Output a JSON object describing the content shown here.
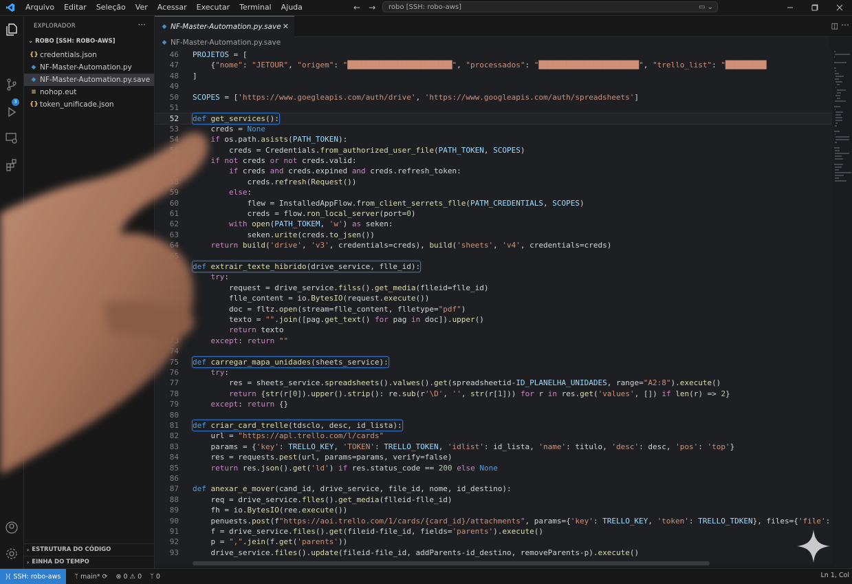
{
  "titlebar": {
    "menu": [
      "Arquivo",
      "Editar",
      "Seleção",
      "Ver",
      "Acessar",
      "Executar",
      "Terminal",
      "Ajuda"
    ],
    "search_text": "robo [SSH: robo-aws]",
    "nav_back": "←",
    "nav_forward": "→"
  },
  "sidebar": {
    "title": "EXPLORADOR",
    "more": "···",
    "root": "ROBO [SSH: ROBO-AWS]",
    "files": [
      {
        "name": "credentials.json",
        "icon": "{}"
      },
      {
        "name": "NF-Master-Automation.py",
        "icon": "py"
      },
      {
        "name": "NF-Master-Automation.py.save",
        "icon": "py"
      },
      {
        "name": "nohop.eut",
        "icon": "≡"
      },
      {
        "name": "token_unificade.json",
        "icon": "{}"
      }
    ],
    "sections": [
      "ESTRUTURA DO CÓDIGO",
      "EINHA DO TEMPO"
    ]
  },
  "editor": {
    "tab_label": "NF-Master-Automation.py.save",
    "breadcrumb": "NF-Master-Automation.py.save",
    "lines": [
      {
        "n": "46",
        "code": "PROJETOS = ["
      },
      {
        "n": "47",
        "code": "    {\"nome\": \"JETOUR\", \"origem\": \"███████████████████████\", \"processados\": \"██████████████████████\", \"trello_list\": \"█████████"
      },
      {
        "n": "48",
        "code": "]"
      },
      {
        "n": "49",
        "code": ""
      },
      {
        "n": "50",
        "code": "SCOPES = ['https://www.goegleapis.com/auth/drive', 'https://www.googleapis.com/auth/spreadsheets']"
      },
      {
        "n": "51",
        "code": ""
      },
      {
        "n": "52",
        "code": "def get_services():"
      },
      {
        "n": "53",
        "code": "    creds = None"
      },
      {
        "n": "54",
        "code": "    if os.path.asists(PATH_TOKEN):"
      },
      {
        "n": "55",
        "code": "        creds = Credentials.from_authorized_user_file(PATH_TOKEN, SCOPES)"
      },
      {
        "n": "56",
        "code": "    if not creds or not creds.valid:"
      },
      {
        "n": "57",
        "code": "        if creds and creds.expined and creds.refresh_token:"
      },
      {
        "n": "58",
        "code": "            creds.refresh(Request())"
      },
      {
        "n": "59",
        "code": "        else:"
      },
      {
        "n": "60",
        "code": "            flew = InstalledAppFlow.from_client_serrets_flle(PATM_CREDENTIALS, SCOPES)"
      },
      {
        "n": "61",
        "code": "            creds = flow.ron_local_server(port=0)"
      },
      {
        "n": "62",
        "code": "        with open(PATH_TOKEM, 'w') as seken:"
      },
      {
        "n": "63",
        "code": "            seken.urite(creds.to_jsen())"
      },
      {
        "n": "64",
        "code": "    return build('drive', 'v3', credentials=creds), build('sheets', 'v4', credentials=creds)"
      },
      {
        "n": "65",
        "code": ""
      },
      {
        "n": "66",
        "code": "def extrair_texte_hibrido(drive_service, flle_id):"
      },
      {
        "n": "67",
        "code": "    try:"
      },
      {
        "n": "68",
        "code": "        request = drive_service.filss().get_media(flleid=flle_id)"
      },
      {
        "n": "69",
        "code": "        flle_content = io.BytesIO(request.execute())"
      },
      {
        "n": "70",
        "code": "        doc = fltz.open(stream=flle_content, flletype=\"pdf\")"
      },
      {
        "n": "71",
        "code": "        texto = \"\".join([pag.get_text() for pag in doc]).upper()"
      },
      {
        "n": "72",
        "code": "        return texto"
      },
      {
        "n": "73",
        "code": "    except: return \"\""
      },
      {
        "n": "74",
        "code": ""
      },
      {
        "n": "75",
        "code": "def carregar_mapa_unidades(sheets_service):"
      },
      {
        "n": "76",
        "code": "    try:"
      },
      {
        "n": "77",
        "code": "        res = sheets_service.spreadsheets().valwes().get(spreadsheetid-ID_PLANELHA_UNIDADES, range=\"A2:8\").execute()"
      },
      {
        "n": "78",
        "code": "        return {str(r[0]).upper().strip(): re.sub(r'\\D', '', str(r[1])) for r in res.get('values', []) if len(r) => 2}"
      },
      {
        "n": "79",
        "code": "    except: return {}"
      },
      {
        "n": "80",
        "code": ""
      },
      {
        "n": "81",
        "code": "def criar_card_trelle(tdsclo, desc, id_lista):"
      },
      {
        "n": "82",
        "code": "    url = \"https://apl.trello.com/l/cards\""
      },
      {
        "n": "83",
        "code": "    params = {'key': TRELLO_KEY, 'TOKEN': TRELLO_TOKEN, 'idlist': id_lista, 'name': titulo, 'desc': desc, 'pos': 'top'}"
      },
      {
        "n": "84",
        "code": "    res = requests.pest(url, params=params, verify=false)"
      },
      {
        "n": "85",
        "code": "    return res.json().get('ld') if res.status_code == 200 else None"
      },
      {
        "n": "86",
        "code": ""
      },
      {
        "n": "87",
        "code": "def anexar_e_mover(cand_id, drive_service, file_id, nome, id_destino):"
      },
      {
        "n": "88",
        "code": "    req = drive_service.flles().get_media(flleid-flle_id)"
      },
      {
        "n": "89",
        "code": "    fh = io.BytesIO(ree.execute())"
      },
      {
        "n": "90",
        "code": "    penuests.post(f\"https://aoi.trello.com/1/cards/{card_id}/attachments\", params={'key': TRELLO_KEY, 'token': TRELLO_TDKEN}, files={'file': (nome, fh.get"
      },
      {
        "n": "91",
        "code": "    f = drive_service.files().get(fileid-file_id, fields='parents').execute()"
      },
      {
        "n": "92",
        "code": "    p = \",\".jein(f.get('parents'))"
      },
      {
        "n": "93",
        "code": "    drive_service.files().update(fileid-file_id, addParents-id_destino, removeParents-p).execute()"
      }
    ]
  },
  "statusbar": {
    "remote": "SSH: robo-aws",
    "branch": "main*",
    "problems": "⊗ 0 ⚠ 0",
    "ports": "0",
    "position": "Ln 1, Col"
  },
  "colors": {
    "accent": "#2f7fd1",
    "keyword": "#569cd6",
    "function": "#dcdcaa",
    "string": "#ce9178",
    "number": "#b5cea8",
    "control": "#c586c0",
    "variable": "#9cdcfe"
  }
}
